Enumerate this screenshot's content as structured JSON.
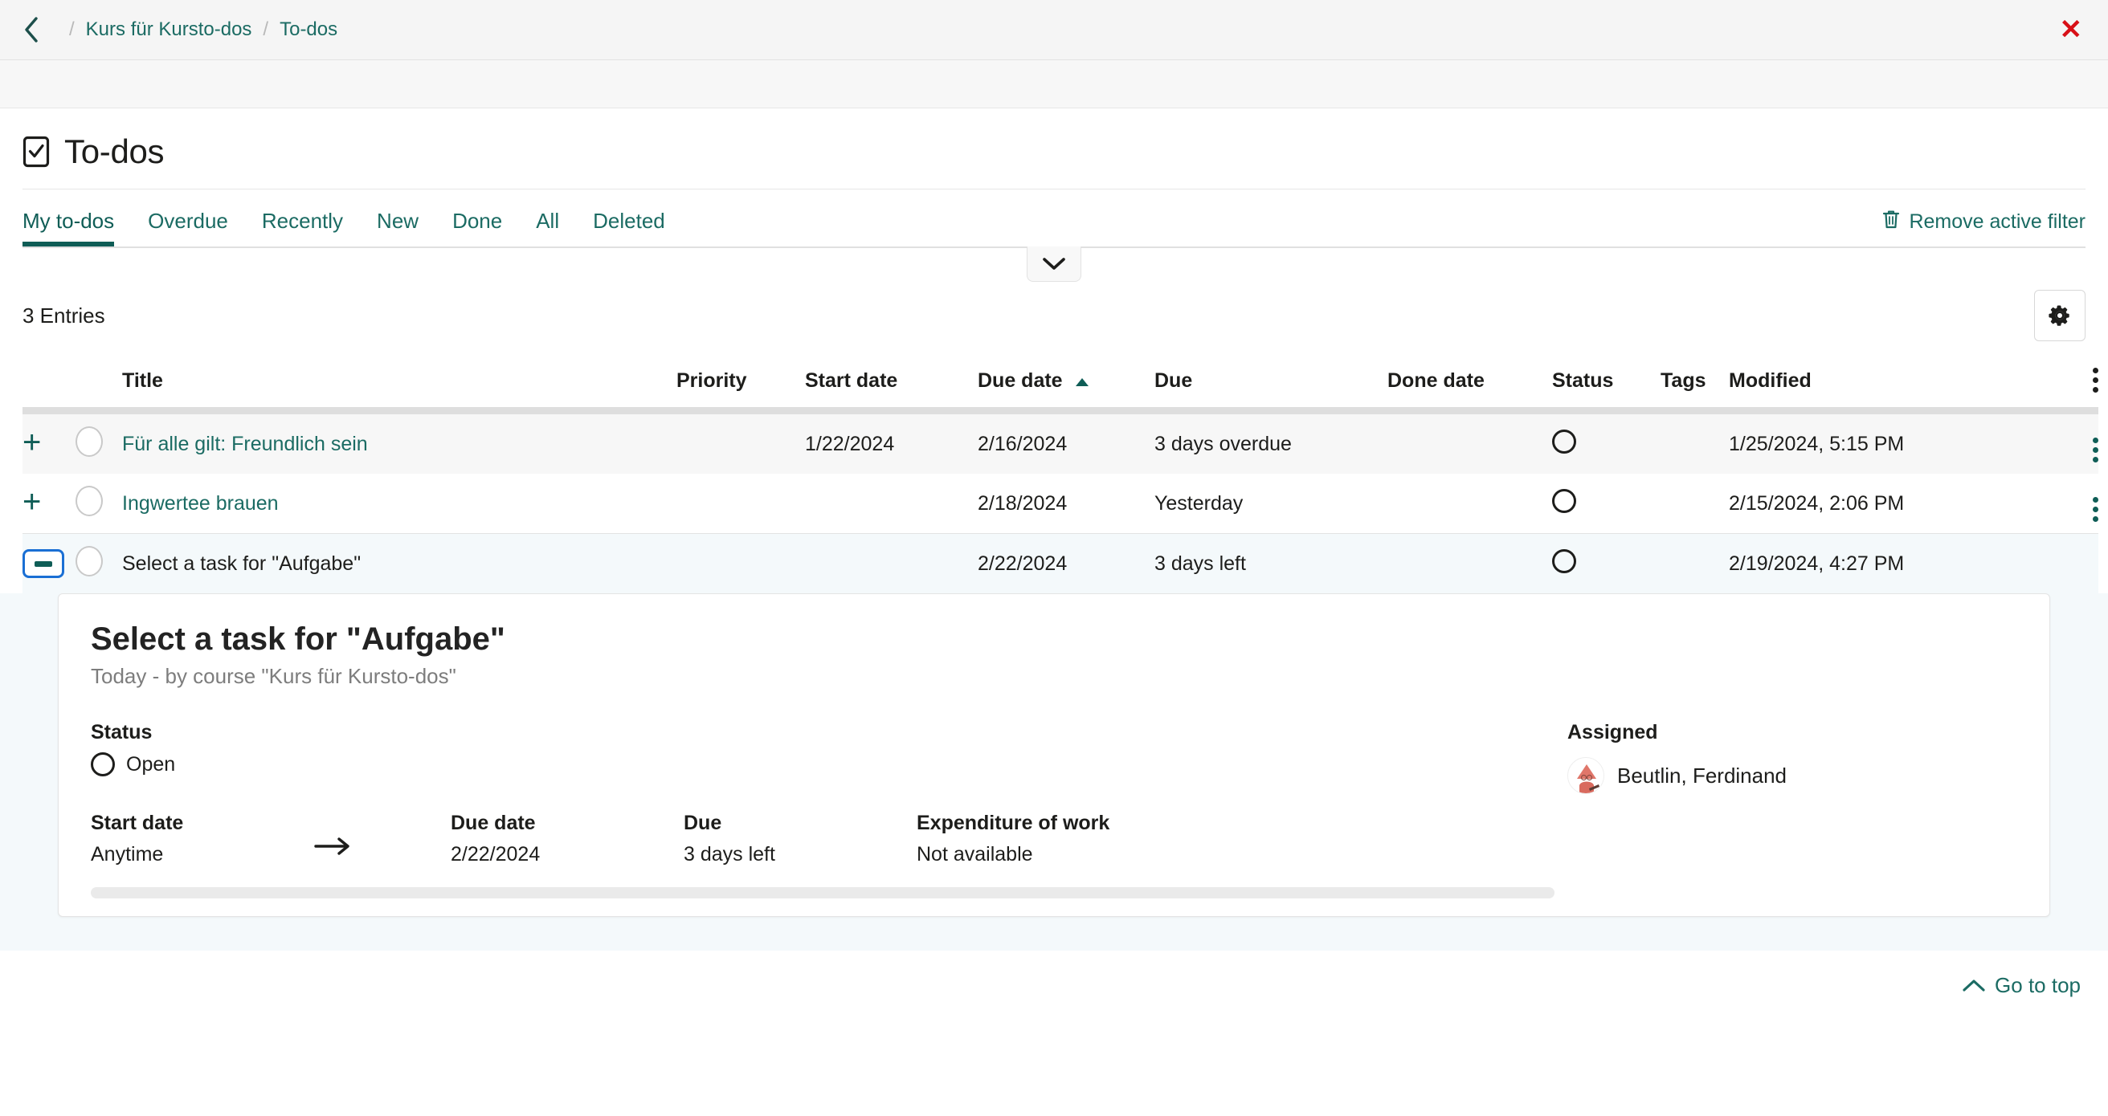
{
  "breadcrumb": {
    "back_icon": "chevron-left-icon",
    "separator": "/",
    "items": [
      {
        "label": "Kurs für Kursto-dos"
      },
      {
        "label": "To-dos"
      }
    ],
    "close_label": "✕"
  },
  "page": {
    "icon": "checkbox-checked-icon",
    "title": "To-dos"
  },
  "tabs": [
    {
      "label": "My to-dos",
      "active": true
    },
    {
      "label": "Overdue",
      "active": false
    },
    {
      "label": "Recently",
      "active": false
    },
    {
      "label": "New",
      "active": false
    },
    {
      "label": "Done",
      "active": false
    },
    {
      "label": "All",
      "active": false
    },
    {
      "label": "Deleted",
      "active": false
    }
  ],
  "filter": {
    "icon": "trash-icon",
    "label": "Remove active filter"
  },
  "expander": {
    "icon": "chevron-down-icon"
  },
  "toolbar": {
    "entries_count": "3 Entries",
    "settings_icon": "gear-icon"
  },
  "table": {
    "columns": [
      "Title",
      "Priority",
      "Start date",
      "Due date",
      "Due",
      "Done date",
      "Status",
      "Tags",
      "Modified"
    ],
    "sorted_column": "Due date",
    "sort_direction": "asc",
    "header_menu_icon": "kebab-menu-icon",
    "rows": [
      {
        "expander": "plus",
        "title": "Für alle gilt: Freundlich sein",
        "title_is_link": true,
        "priority": "",
        "start_date": "1/22/2024",
        "due_date": "2/16/2024",
        "due_date_overdue": true,
        "due": "3 days overdue",
        "due_overdue": true,
        "done_date": "",
        "status": "open",
        "tags": "",
        "modified": "1/25/2024, 5:15 PM"
      },
      {
        "expander": "plus",
        "title": "Ingwertee brauen",
        "title_is_link": true,
        "priority": "",
        "start_date": "",
        "due_date": "2/18/2024",
        "due_date_overdue": true,
        "due": "Yesterday",
        "due_overdue": true,
        "done_date": "",
        "status": "open",
        "tags": "",
        "modified": "2/15/2024, 2:06 PM"
      },
      {
        "expander": "minus",
        "title": "Select a task for \"Aufgabe\"",
        "title_is_link": false,
        "priority": "",
        "start_date": "",
        "due_date": "2/22/2024",
        "due_date_overdue": false,
        "due": "3 days left",
        "due_overdue": false,
        "done_date": "",
        "status": "open",
        "tags": "",
        "modified": "2/19/2024, 4:27 PM"
      }
    ]
  },
  "detail": {
    "title": "Select a task for \"Aufgabe\"",
    "subtitle": "Today - by course \"Kurs für Kursto-dos\"",
    "status_label": "Status",
    "status_value": "Open",
    "start_date_label": "Start date",
    "start_date_value": "Anytime",
    "arrow_icon": "arrow-right-icon",
    "due_date_label": "Due date",
    "due_date_value": "2/22/2024",
    "due_label": "Due",
    "due_value": "3 days left",
    "expenditure_label": "Expenditure of work",
    "expenditure_value": "Not available",
    "assigned_label": "Assigned",
    "assigned_name": "Beutlin, Ferdinand"
  },
  "footer": {
    "go_top_icon": "chevron-up-icon",
    "go_top_label": "Go to top"
  },
  "colors": {
    "accent": "#1b6b63",
    "accent_dark": "#0f5d56",
    "danger": "#d81017",
    "focus_blue": "#1a6fd4",
    "row_alt": "#f7f7f7",
    "row_open": "#f4f9fb"
  }
}
